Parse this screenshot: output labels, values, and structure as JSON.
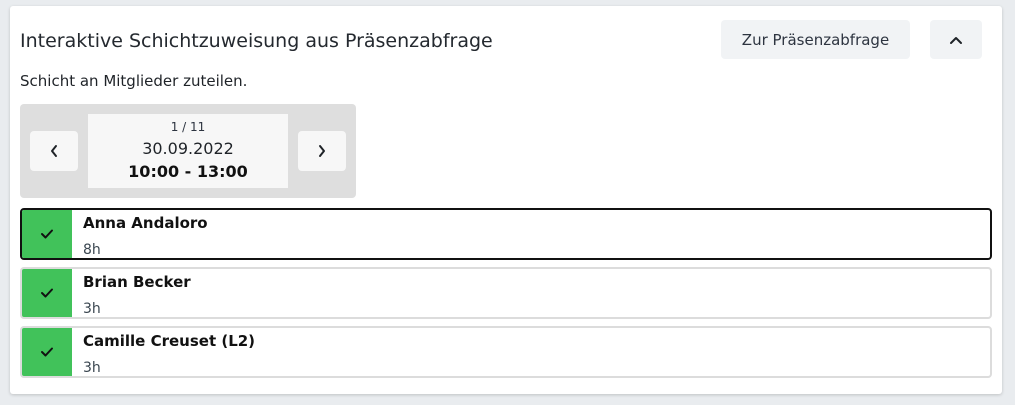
{
  "header": {
    "title": "Interaktive Schichtzuweisung aus Präsenzabfrage",
    "poll_button_label": "Zur Präsenzabfrage",
    "collapse_icon": "chevron-up-icon"
  },
  "subtitle": "Schicht an Mitglieder zuteilen.",
  "shift": {
    "counter": "1 / 11",
    "date": "30.09.2022",
    "time": "10:00 - 13:00",
    "prev_icon": "chevron-left-icon",
    "next_icon": "chevron-right-icon"
  },
  "members": [
    {
      "name": "Anna Andaloro",
      "hours": "8h",
      "assigned": true,
      "selected": true
    },
    {
      "name": "Brian Becker",
      "hours": "3h",
      "assigned": true,
      "selected": false
    },
    {
      "name": "Camille Creuset (L2)",
      "hours": "3h",
      "assigned": true,
      "selected": false
    }
  ],
  "colors": {
    "assigned_green": "#41c25a",
    "selected_border": "#111111",
    "row_border": "#dcdcdc"
  }
}
